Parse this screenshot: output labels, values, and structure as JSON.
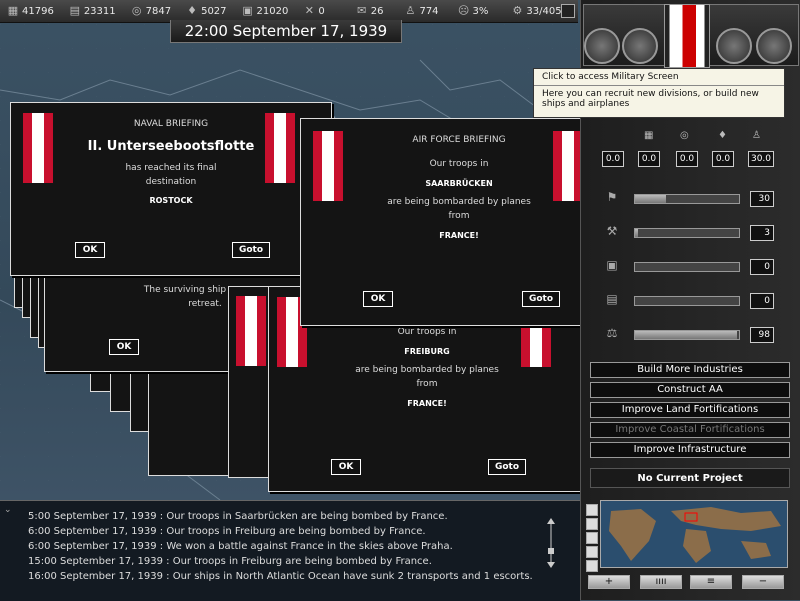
{
  "resources": [
    {
      "icon": "coal-icon",
      "value": "41796"
    },
    {
      "icon": "steel-icon",
      "value": "23311"
    },
    {
      "icon": "rubber-icon",
      "value": "7847"
    },
    {
      "icon": "oil-icon",
      "value": "5027"
    },
    {
      "icon": "supplies-icon",
      "value": "21020"
    },
    {
      "icon": "transport-icon",
      "value": "0"
    },
    {
      "icon": "money-icon",
      "value": "26"
    },
    {
      "icon": "manpower-icon",
      "value": "774"
    },
    {
      "icon": "dissent-icon",
      "value": "3%"
    },
    {
      "icon": "ic-icon",
      "value": "33/405"
    }
  ],
  "clock": "22:00 September 17, 1939",
  "tooltip": {
    "title": "Click to access Military Screen",
    "body": "Here you can recruit new divisions, or build new ships and airplanes"
  },
  "naval": {
    "title": "NAVAL BRIEFING",
    "unit": "II. Unterseebootsflotte",
    "line1": "has reached its final",
    "line2": "destination",
    "place": "ROSTOCK",
    "ok": "OK",
    "goto": "Goto"
  },
  "behind_popup": {
    "line1": "The surviving ship",
    "line2": "retreat.",
    "ok": "OK"
  },
  "air1": {
    "title": "AIR FORCE BRIEFING",
    "line1": "Our troops in",
    "place": "SAARBRÜCKEN",
    "line2": "are being bombarded by planes",
    "line3": "from",
    "enemy": "FRANCE!",
    "ok": "OK",
    "goto": "Goto"
  },
  "air2": {
    "line1": "Our troops in",
    "place": "FREIBURG",
    "line2": "are being bombarded by planes",
    "line3": "from",
    "enemy": "FRANCE!",
    "ok": "OK",
    "goto": "Goto"
  },
  "stats": [
    "0.0",
    "0.0",
    "0.0",
    "0.0",
    "30.0"
  ],
  "sliders": [
    {
      "value": "30",
      "fill": 0.3
    },
    {
      "value": "3",
      "fill": 0.03
    },
    {
      "value": "0",
      "fill": 0
    },
    {
      "value": "0",
      "fill": 0
    },
    {
      "value": "98",
      "fill": 0.98
    }
  ],
  "projects": [
    {
      "label": "Build More Industries",
      "enabled": true
    },
    {
      "label": "Construct AA",
      "enabled": true
    },
    {
      "label": "Improve Land Fortifications",
      "enabled": true
    },
    {
      "label": "Improve Coastal Fortifications",
      "enabled": false
    },
    {
      "label": "Improve Infrastructure",
      "enabled": true
    }
  ],
  "no_project": "No Current Project",
  "minimap_buttons": [
    "+",
    "ıııı",
    "≡",
    "−"
  ],
  "log": [
    "5:00 September 17, 1939 : Our troops in Saarbrücken are being bombed by France.",
    "6:00 September 17, 1939 : Our troops in Freiburg are being bombed by France.",
    "6:00 September 17, 1939 : We won a battle against France in the skies above Praha.",
    "15:00 September 17, 1939 : Our troops in Freiburg are being bombed by France.",
    "16:00 September 17, 1939 : Our ships in North Atlantic Ocean have sunk 2 transports and 1 escorts."
  ]
}
